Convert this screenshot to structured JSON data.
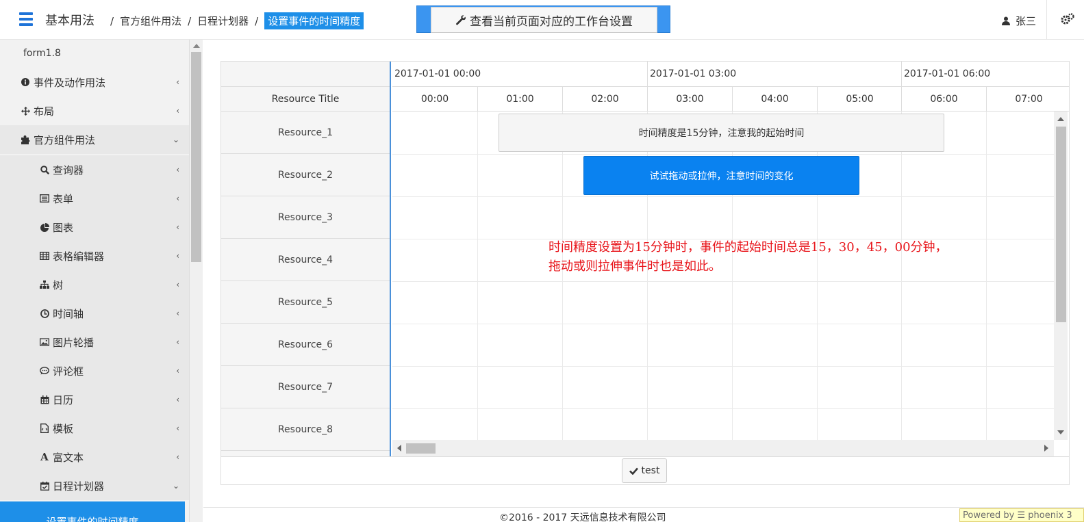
{
  "header": {
    "app_title": "基本用法",
    "breadcrumb": [
      "官方组件用法",
      "日程计划器"
    ],
    "breadcrumb_current": "设置事件的时间精度",
    "workspace_button": "查看当前页面对应的工作台设置",
    "user_name": "张三"
  },
  "sidebar": {
    "form_version": "form1.8",
    "items": [
      {
        "label": "事件及动作用法",
        "icon": "info-circle-icon"
      },
      {
        "label": "布局",
        "icon": "move-icon"
      },
      {
        "label": "官方组件用法",
        "icon": "puzzle-icon"
      },
      {
        "label": "查询器",
        "icon": "search-icon"
      },
      {
        "label": "表单",
        "icon": "form-icon"
      },
      {
        "label": "图表",
        "icon": "pie-chart-icon"
      },
      {
        "label": "表格编辑器",
        "icon": "table-icon"
      },
      {
        "label": "树",
        "icon": "sitemap-icon"
      },
      {
        "label": "时间轴",
        "icon": "clock-icon"
      },
      {
        "label": "图片轮播",
        "icon": "image-icon"
      },
      {
        "label": "评论框",
        "icon": "comment-icon"
      },
      {
        "label": "日历",
        "icon": "calendar-icon"
      },
      {
        "label": "模板",
        "icon": "template-icon"
      },
      {
        "label": "富文本",
        "icon": "font-icon"
      },
      {
        "label": "日程计划器",
        "icon": "calendar-check-icon"
      }
    ],
    "active_item": "设置事件的时间精度"
  },
  "scheduler": {
    "resource_title": "Resource Title",
    "dates": [
      "2017-01-01 00:00",
      "2017-01-01 03:00",
      "2017-01-01 06:00"
    ],
    "hours": [
      "00:00",
      "01:00",
      "02:00",
      "03:00",
      "04:00",
      "05:00",
      "06:00",
      "07:00"
    ],
    "resources": [
      "Resource_1",
      "Resource_2",
      "Resource_3",
      "Resource_4",
      "Resource_5",
      "Resource_6",
      "Resource_7",
      "Resource_8"
    ],
    "events": [
      {
        "label": "时间精度是15分钟，注意我的起始时间",
        "resource": "Resource_1",
        "start": "01:15",
        "end": "06:30"
      },
      {
        "label": "试试拖动或拉伸，注意时间的变化",
        "resource": "Resource_2",
        "start": "02:15",
        "end": "05:30"
      }
    ],
    "note_line1": "时间精度设置为15分钟时，事件的起始时间总是15，30，45，00分钟，",
    "note_line2": "拖动或则拉伸事件时也是如此。"
  },
  "test_button": "test",
  "footer": {
    "copyright": "©2016 - 2017 天远信息技术有限公司",
    "powered": "Powered by ☰ phoenix 3"
  },
  "colors": {
    "accent": "#1e8fe8",
    "event_blue": "#0a82f0",
    "note_red": "#e8141a"
  }
}
